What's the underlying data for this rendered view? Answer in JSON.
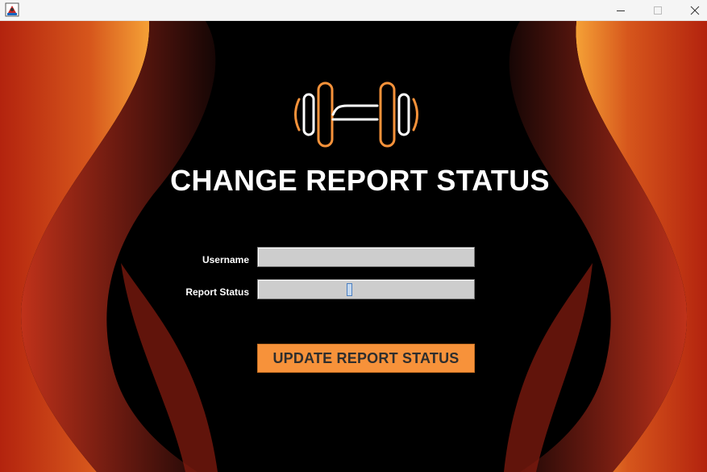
{
  "window": {
    "icon": "java-app-icon",
    "controls": [
      "minimize",
      "maximize",
      "close"
    ]
  },
  "logo": {
    "icon": "dumbbell-icon",
    "colors": [
      "#ffffff",
      "#f7923a"
    ]
  },
  "header": {
    "title": "CHANGE REPORT STATUS"
  },
  "form": {
    "username_label": "Username",
    "username_value": "",
    "status_label": "Report Status",
    "status_value": ""
  },
  "actions": {
    "update_label": "UPDATE REPORT STATUS"
  },
  "colors": {
    "accent": "#f7923a",
    "background": "#000000",
    "flame_red": "#b71c0c",
    "flame_orange": "#f59a2e"
  }
}
